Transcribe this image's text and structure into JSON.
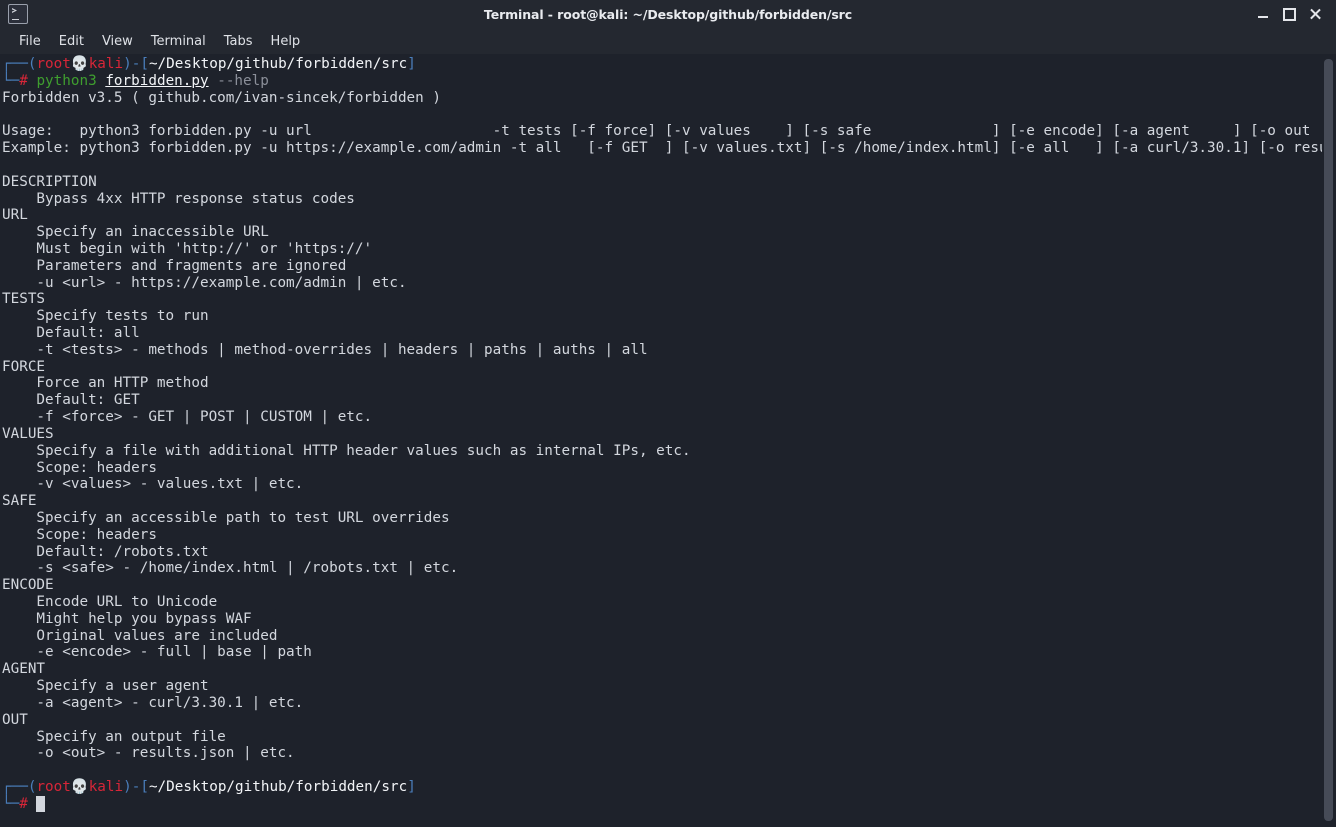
{
  "window": {
    "title": "Terminal - root@kali: ~/Desktop/github/forbidden/src",
    "icon": "terminal-icon",
    "controls": {
      "minimize": "minimize-icon",
      "maximize": "maximize-icon",
      "close": "close-icon"
    }
  },
  "menubar": {
    "items": [
      {
        "label": "File"
      },
      {
        "label": "Edit"
      },
      {
        "label": "View"
      },
      {
        "label": "Terminal"
      },
      {
        "label": "Tabs"
      },
      {
        "label": "Help"
      }
    ]
  },
  "colors": {
    "background": "#1e222b",
    "chrome": "#242830",
    "foreground": "#d3d7de",
    "prompt_bracket": "#4a7ebb",
    "prompt_user": "#d72638",
    "prompt_path": "#f2f4f7",
    "command_keyword": "#3f9e2f",
    "command_flag": "#8b8f99",
    "scrollbar_thumb": "#464b57"
  },
  "terminal": {
    "prompt_top": {
      "corner": "┌──",
      "open_paren": "(",
      "user": "root",
      "skull": "💀",
      "host": "kali",
      "close_paren": ")",
      "dash": "-",
      "open_bracket": "[",
      "path": "~/Desktop/github/forbidden/src",
      "close_bracket": "]"
    },
    "prompt_bottom": {
      "corner": "└─",
      "hash": "#"
    },
    "command": {
      "interpreter": "python3",
      "script": "forbidden.py",
      "flag": "--help"
    },
    "cursor": " ",
    "output": [
      "Forbidden v3.5 ( github.com/ivan-sincek/forbidden )",
      "",
      "Usage:   python3 forbidden.py -u url                     -t tests [-f force] [-v values    ] [-s safe              ] [-e encode] [-a agent     ] [-o out          ]",
      "Example: python3 forbidden.py -u https://example.com/admin -t all   [-f GET  ] [-v values.txt] [-s /home/index.html] [-e all   ] [-a curl/3.30.1] [-o results.json]",
      "",
      "DESCRIPTION",
      "    Bypass 4xx HTTP response status codes",
      "URL",
      "    Specify an inaccessible URL",
      "    Must begin with 'http://' or 'https://'",
      "    Parameters and fragments are ignored",
      "    -u <url> - https://example.com/admin | etc.",
      "TESTS",
      "    Specify tests to run",
      "    Default: all",
      "    -t <tests> - methods | method-overrides | headers | paths | auths | all",
      "FORCE",
      "    Force an HTTP method",
      "    Default: GET",
      "    -f <force> - GET | POST | CUSTOM | etc.",
      "VALUES",
      "    Specify a file with additional HTTP header values such as internal IPs, etc.",
      "    Scope: headers",
      "    -v <values> - values.txt | etc.",
      "SAFE",
      "    Specify an accessible path to test URL overrides",
      "    Scope: headers",
      "    Default: /robots.txt",
      "    -s <safe> - /home/index.html | /robots.txt | etc.",
      "ENCODE",
      "    Encode URL to Unicode",
      "    Might help you bypass WAF",
      "    Original values are included",
      "    -e <encode> - full | base | path",
      "AGENT",
      "    Specify a user agent",
      "    -a <agent> - curl/3.30.1 | etc.",
      "OUT",
      "    Specify an output file",
      "    -o <out> - results.json | etc.",
      ""
    ]
  }
}
